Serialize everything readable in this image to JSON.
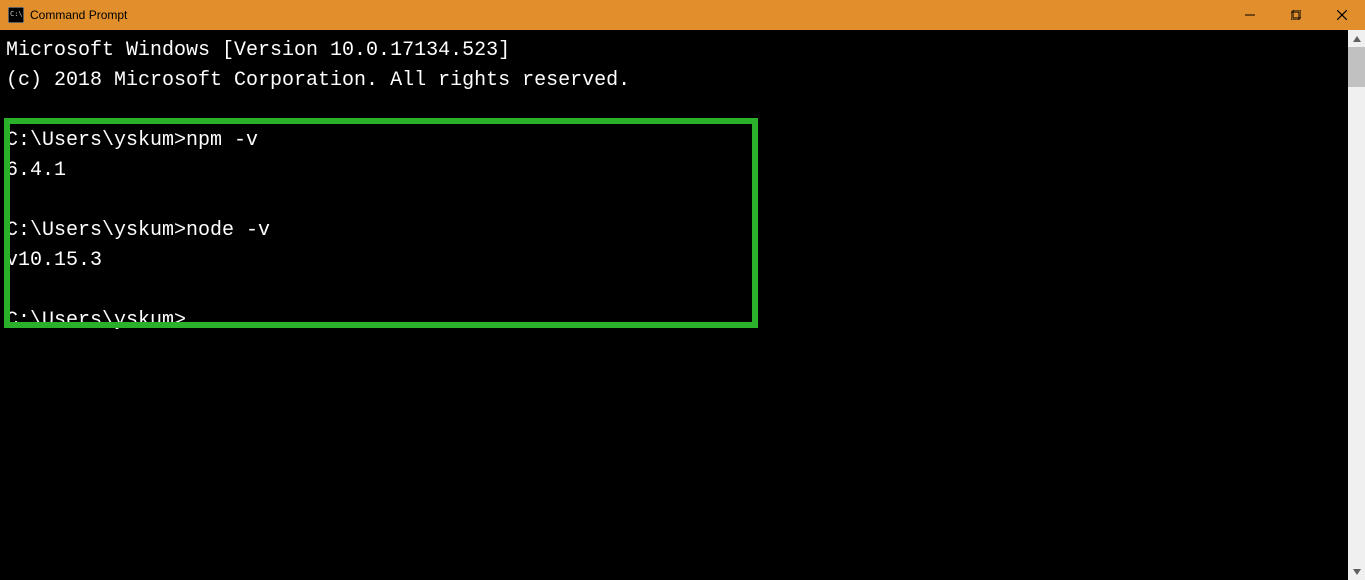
{
  "window": {
    "title": "Command Prompt"
  },
  "terminal": {
    "line1": "Microsoft Windows [Version 10.0.17134.523]",
    "line2": "(c) 2018 Microsoft Corporation. All rights reserved.",
    "blank1": "",
    "prompt1": "C:\\Users\\yskum>npm -v",
    "result1": "6.4.1",
    "blank2": "",
    "prompt2": "C:\\Users\\yskum>node -v",
    "result2": "v10.15.3",
    "blank3": "",
    "prompt3": "C:\\Users\\yskum>"
  }
}
